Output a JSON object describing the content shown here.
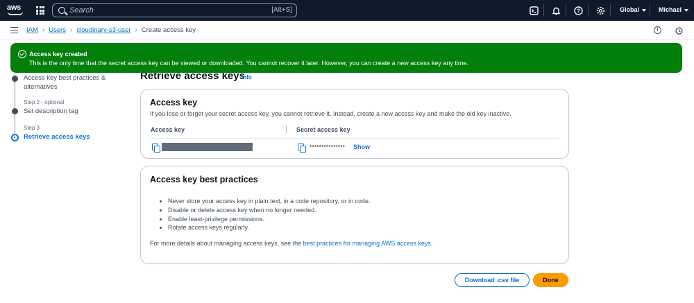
{
  "topnav": {
    "search_placeholder": "Search",
    "search_shortcut": "[Alt+S]",
    "region": "Global",
    "user": "Michael"
  },
  "breadcrumb": {
    "items": [
      "IAM",
      "Users",
      "cloudinary-s3-user"
    ],
    "current": "Create access key"
  },
  "flash": {
    "title": "Access key created",
    "message": "This is the only time that the secret access key can be viewed or downloaded. You cannot recover it later. However, you can create a new access key any time."
  },
  "steps": [
    {
      "small": "",
      "label": "Access key best practices & alternatives"
    },
    {
      "small": "Step 2 - optional",
      "label": "Set description tag"
    },
    {
      "small": "Step 3",
      "label": "Retrieve access keys"
    }
  ],
  "page": {
    "title": "Retrieve access keys",
    "info": "Info"
  },
  "access_key_card": {
    "title": "Access key",
    "description": "If you lose or forget your secret access key, you cannot retrieve it. Instead, create a new access key and make the old key inactive.",
    "col_access_key": "Access key",
    "col_secret": "Secret access key",
    "secret_masked": "***************",
    "show_label": "Show"
  },
  "best_practices_card": {
    "title": "Access key best practices",
    "items": [
      "Never store your access key in plain text, in a code repository, or in code.",
      "Disable or delete access key when no longer needed.",
      "Enable least-privilege permissions.",
      "Rotate access keys regularly."
    ],
    "more_prefix": "For more details about managing access keys, see the ",
    "more_link": "best practices for managing AWS access keys",
    "more_suffix": "."
  },
  "actions": {
    "download": "Download .csv file",
    "done": "Done"
  },
  "colors": {
    "nav_bg": "#0f1b2a",
    "flash_green": "#037f0c",
    "link_blue": "#0972d3",
    "primary_orange": "#ff9900"
  }
}
